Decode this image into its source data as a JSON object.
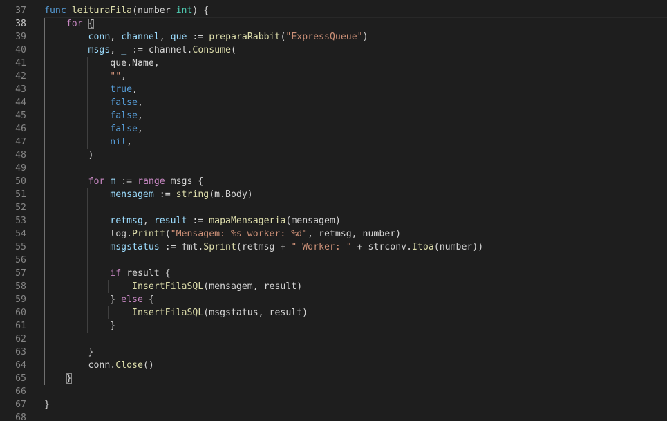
{
  "editor": {
    "first_line_number": 37,
    "active_line": 38,
    "lines": [
      {
        "n": 37,
        "indent": 0,
        "tokens": [
          [
            "kw",
            "func"
          ],
          [
            "op",
            " "
          ],
          [
            "fn",
            "leituraFila"
          ],
          [
            "op",
            "("
          ],
          [
            "op",
            "number "
          ],
          [
            "ty",
            "int"
          ],
          [
            "op",
            ") {"
          ]
        ]
      },
      {
        "n": 38,
        "indent": 1,
        "tokens": [
          [
            "ctl",
            "for"
          ],
          [
            "op",
            " "
          ],
          [
            "box",
            "{"
          ]
        ]
      },
      {
        "n": 39,
        "indent": 2,
        "tokens": [
          [
            "var",
            "conn"
          ],
          [
            "op",
            ", "
          ],
          [
            "var",
            "channel"
          ],
          [
            "op",
            ", "
          ],
          [
            "var",
            "que"
          ],
          [
            "op",
            " := "
          ],
          [
            "fn",
            "preparaRabbit"
          ],
          [
            "op",
            "("
          ],
          [
            "str",
            "\"ExpressQueue\""
          ],
          [
            "op",
            ")"
          ]
        ]
      },
      {
        "n": 40,
        "indent": 2,
        "tokens": [
          [
            "var",
            "msgs"
          ],
          [
            "op",
            ", "
          ],
          [
            "var",
            "_"
          ],
          [
            "op",
            " := channel."
          ],
          [
            "fn",
            "Consume"
          ],
          [
            "op",
            "("
          ]
        ]
      },
      {
        "n": 41,
        "indent": 3,
        "tokens": [
          [
            "op",
            "que.Name,"
          ]
        ]
      },
      {
        "n": 42,
        "indent": 3,
        "tokens": [
          [
            "str",
            "\"\""
          ],
          [
            "op",
            ","
          ]
        ]
      },
      {
        "n": 43,
        "indent": 3,
        "tokens": [
          [
            "kw",
            "true"
          ],
          [
            "op",
            ","
          ]
        ]
      },
      {
        "n": 44,
        "indent": 3,
        "tokens": [
          [
            "kw",
            "false"
          ],
          [
            "op",
            ","
          ]
        ]
      },
      {
        "n": 45,
        "indent": 3,
        "tokens": [
          [
            "kw",
            "false"
          ],
          [
            "op",
            ","
          ]
        ]
      },
      {
        "n": 46,
        "indent": 3,
        "tokens": [
          [
            "kw",
            "false"
          ],
          [
            "op",
            ","
          ]
        ]
      },
      {
        "n": 47,
        "indent": 3,
        "tokens": [
          [
            "kw",
            "nil"
          ],
          [
            "op",
            ","
          ]
        ]
      },
      {
        "n": 48,
        "indent": 2,
        "tokens": [
          [
            "op",
            ")"
          ]
        ]
      },
      {
        "n": 49,
        "indent": 0,
        "tokens": []
      },
      {
        "n": 50,
        "indent": 2,
        "tokens": [
          [
            "ctl",
            "for"
          ],
          [
            "op",
            " "
          ],
          [
            "var",
            "m"
          ],
          [
            "op",
            " := "
          ],
          [
            "ctl",
            "range"
          ],
          [
            "op",
            " msgs {"
          ]
        ]
      },
      {
        "n": 51,
        "indent": 3,
        "tokens": [
          [
            "var",
            "mensagem"
          ],
          [
            "op",
            " := "
          ],
          [
            "fn",
            "string"
          ],
          [
            "op",
            "(m.Body)"
          ]
        ]
      },
      {
        "n": 52,
        "indent": 0,
        "tokens": []
      },
      {
        "n": 53,
        "indent": 3,
        "tokens": [
          [
            "var",
            "retmsg"
          ],
          [
            "op",
            ", "
          ],
          [
            "var",
            "result"
          ],
          [
            "op",
            " := "
          ],
          [
            "fn",
            "mapaMensageria"
          ],
          [
            "op",
            "(mensagem)"
          ]
        ]
      },
      {
        "n": 54,
        "indent": 3,
        "tokens": [
          [
            "op",
            "log."
          ],
          [
            "fn",
            "Printf"
          ],
          [
            "op",
            "("
          ],
          [
            "str",
            "\"Mensagem: %s worker: %d\""
          ],
          [
            "op",
            ", retmsg, number)"
          ]
        ]
      },
      {
        "n": 55,
        "indent": 3,
        "tokens": [
          [
            "var",
            "msgstatus"
          ],
          [
            "op",
            " := fmt."
          ],
          [
            "fn",
            "Sprint"
          ],
          [
            "op",
            "(retmsg + "
          ],
          [
            "str",
            "\" Worker: \""
          ],
          [
            "op",
            " + strconv."
          ],
          [
            "fn",
            "Itoa"
          ],
          [
            "op",
            "(number))"
          ]
        ]
      },
      {
        "n": 56,
        "indent": 0,
        "tokens": []
      },
      {
        "n": 57,
        "indent": 3,
        "tokens": [
          [
            "ctl",
            "if"
          ],
          [
            "op",
            " result {"
          ]
        ]
      },
      {
        "n": 58,
        "indent": 4,
        "tokens": [
          [
            "fn",
            "InsertFilaSQL"
          ],
          [
            "op",
            "(mensagem, result)"
          ]
        ]
      },
      {
        "n": 59,
        "indent": 3,
        "tokens": [
          [
            "op",
            "} "
          ],
          [
            "ctl",
            "else"
          ],
          [
            "op",
            " {"
          ]
        ]
      },
      {
        "n": 60,
        "indent": 4,
        "tokens": [
          [
            "fn",
            "InsertFilaSQL"
          ],
          [
            "op",
            "(msgstatus, result)"
          ]
        ]
      },
      {
        "n": 61,
        "indent": 3,
        "tokens": [
          [
            "op",
            "}"
          ]
        ]
      },
      {
        "n": 62,
        "indent": 0,
        "tokens": []
      },
      {
        "n": 63,
        "indent": 2,
        "tokens": [
          [
            "op",
            "}"
          ]
        ]
      },
      {
        "n": 64,
        "indent": 2,
        "tokens": [
          [
            "op",
            "conn."
          ],
          [
            "fn",
            "Close"
          ],
          [
            "op",
            "()"
          ]
        ]
      },
      {
        "n": 65,
        "indent": 1,
        "tokens": [
          [
            "box",
            "}"
          ]
        ]
      },
      {
        "n": 66,
        "indent": 0,
        "tokens": []
      },
      {
        "n": 67,
        "indent": 0,
        "tokens": [
          [
            "op",
            "}"
          ]
        ]
      },
      {
        "n": 68,
        "indent": 0,
        "tokens": []
      }
    ]
  }
}
